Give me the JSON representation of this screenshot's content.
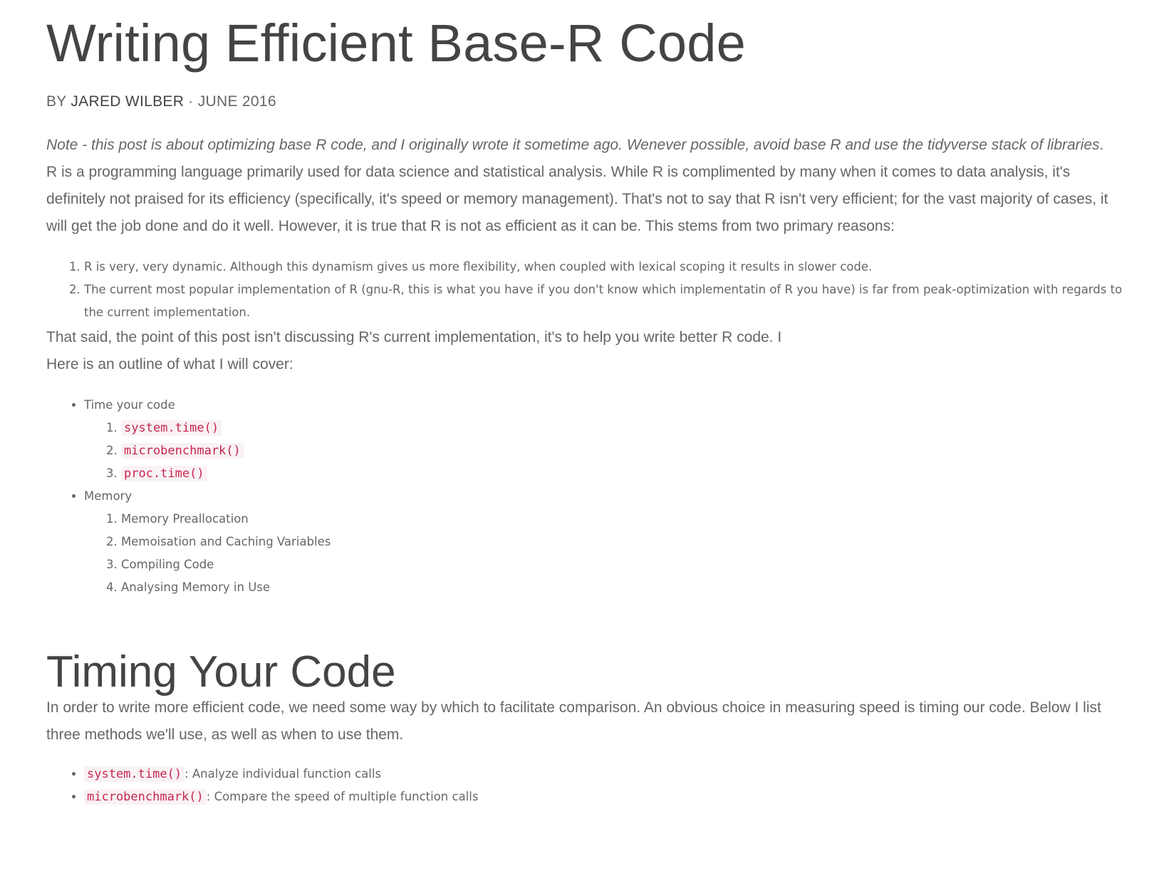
{
  "article": {
    "title": "Writing Efficient Base-R Code",
    "byline_prefix": "BY ",
    "author": "JARED WILBER",
    "byline_sep": " · ",
    "date": "JUNE 2016",
    "note_italic": "Note - this post is about optimizing base R code, and I originally wrote it sometime ago. Wenever possible, avoid base R and use the tidyverse stack of libraries",
    "note_tail": ".",
    "intro": "R is a programming language primarily used for data science and statistical analysis. While R is complimented by many when it comes to data analysis, it's definitely not praised for its efficiency (specifically, it's speed or memory management). That's not to say that R isn't very efficient; for the vast majority of cases, it will get the job done and do it well. However, it is true that R is not as efficient as it can be. This stems from two primary reasons:",
    "reasons": [
      "R is very, very dynamic. Although this dynamism gives us more flexibility, when coupled with lexical scoping it results in slower code.",
      "The current most popular implementation of R (gnu-R, this is what you have if you don't know which implementatin of R you have) is far from peak-optimization with regards to the current implementation."
    ],
    "that_said": "That said, the point of this post isn't discussing R's current implementation, it's to help you write better R code. I",
    "outline_intro": "Here is an outline of what I will cover:",
    "outline": {
      "time_label": "Time your code",
      "time_items": [
        "system.time()",
        "microbenchmark()",
        "proc.time()"
      ],
      "memory_label": "Memory",
      "memory_items": [
        "Memory Preallocation",
        "Memoisation and Caching Variables",
        "Compiling Code",
        "Analysing Memory in Use"
      ]
    }
  },
  "timing_section": {
    "heading": "Timing Your Code",
    "paragraph": "In order to write more efficient code, we need some way by which to facilitate comparison. An obvious choice in measuring speed is timing our code. Below I list three methods we'll use, as well as when to use them.",
    "methods": [
      {
        "code": "system.time()",
        "desc": ": Analyze individual function calls"
      },
      {
        "code": "microbenchmark()",
        "desc": ": Compare the speed of multiple function calls"
      }
    ]
  }
}
